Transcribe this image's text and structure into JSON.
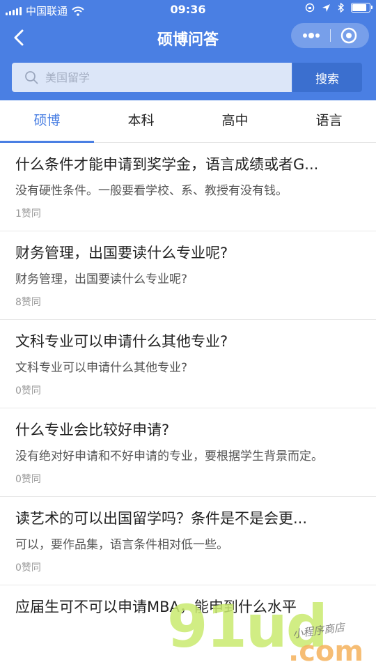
{
  "status_bar": {
    "carrier": "中国联通",
    "time": "09:36",
    "battery_level": 0.9
  },
  "navbar": {
    "title": "硕博问答"
  },
  "search": {
    "placeholder": "美国留学",
    "button_label": "搜索"
  },
  "tabs": [
    {
      "label": "硕博",
      "active": true
    },
    {
      "label": "本科",
      "active": false
    },
    {
      "label": "高中",
      "active": false
    },
    {
      "label": "语言",
      "active": false
    }
  ],
  "questions": [
    {
      "title": "什么条件才能申请到奖学金，语言成绩或者G...",
      "answer": "没有硬性条件。一般要看学校、系、教授有没有钱。",
      "likes": "1赞同"
    },
    {
      "title": "财务管理，出国要读什么专业呢?",
      "answer": "财务管理，出国要读什么专业呢?",
      "likes": "8赞同"
    },
    {
      "title": "文科专业可以申请什么其他专业?",
      "answer": "文科专业可以申请什么其他专业?",
      "likes": "0赞同"
    },
    {
      "title": "什么专业会比较好申请?",
      "answer": "没有绝对好申请和不好申请的专业，要根据学生背景而定。",
      "likes": "0赞同"
    },
    {
      "title": "读艺术的可以出国留学吗？条件是不是会更...",
      "answer": "可以，要作品集，语言条件相对低一些。",
      "likes": "0赞同"
    },
    {
      "title": "应届生可不可以申请MBA，能申到什么水平",
      "answer": "",
      "likes": ""
    }
  ],
  "watermark": {
    "main": "91ud",
    "suffix": ".com",
    "tagline": "小程序商店"
  },
  "colors": {
    "primary": "#4a7fe3",
    "search_button": "#3b6fcf"
  }
}
